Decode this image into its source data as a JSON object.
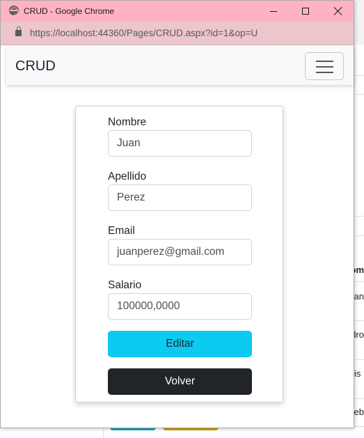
{
  "window": {
    "title": "CRUD - Google Chrome",
    "url": "https://localhost:44360/Pages/CRUD.aspx?id=1&op=U",
    "titlebar_color": "#ffb3c1"
  },
  "navbar": {
    "brand": "CRUD"
  },
  "form": {
    "fields": [
      {
        "label": "Nombre",
        "value": "Juan"
      },
      {
        "label": "Apellido",
        "value": "Perez"
      },
      {
        "label": "Email",
        "value": "juanperez@gmail.com"
      },
      {
        "label": "Salario",
        "value": "100000,0000"
      }
    ],
    "buttons": {
      "edit_label": "Editar",
      "back_label": "Volver"
    }
  },
  "background_table": {
    "header_fragment": "om",
    "cells": [
      "an",
      "dro",
      "is",
      "teb"
    ]
  },
  "colors": {
    "edit_button": "#0dcaf0",
    "back_button": "#212529"
  }
}
